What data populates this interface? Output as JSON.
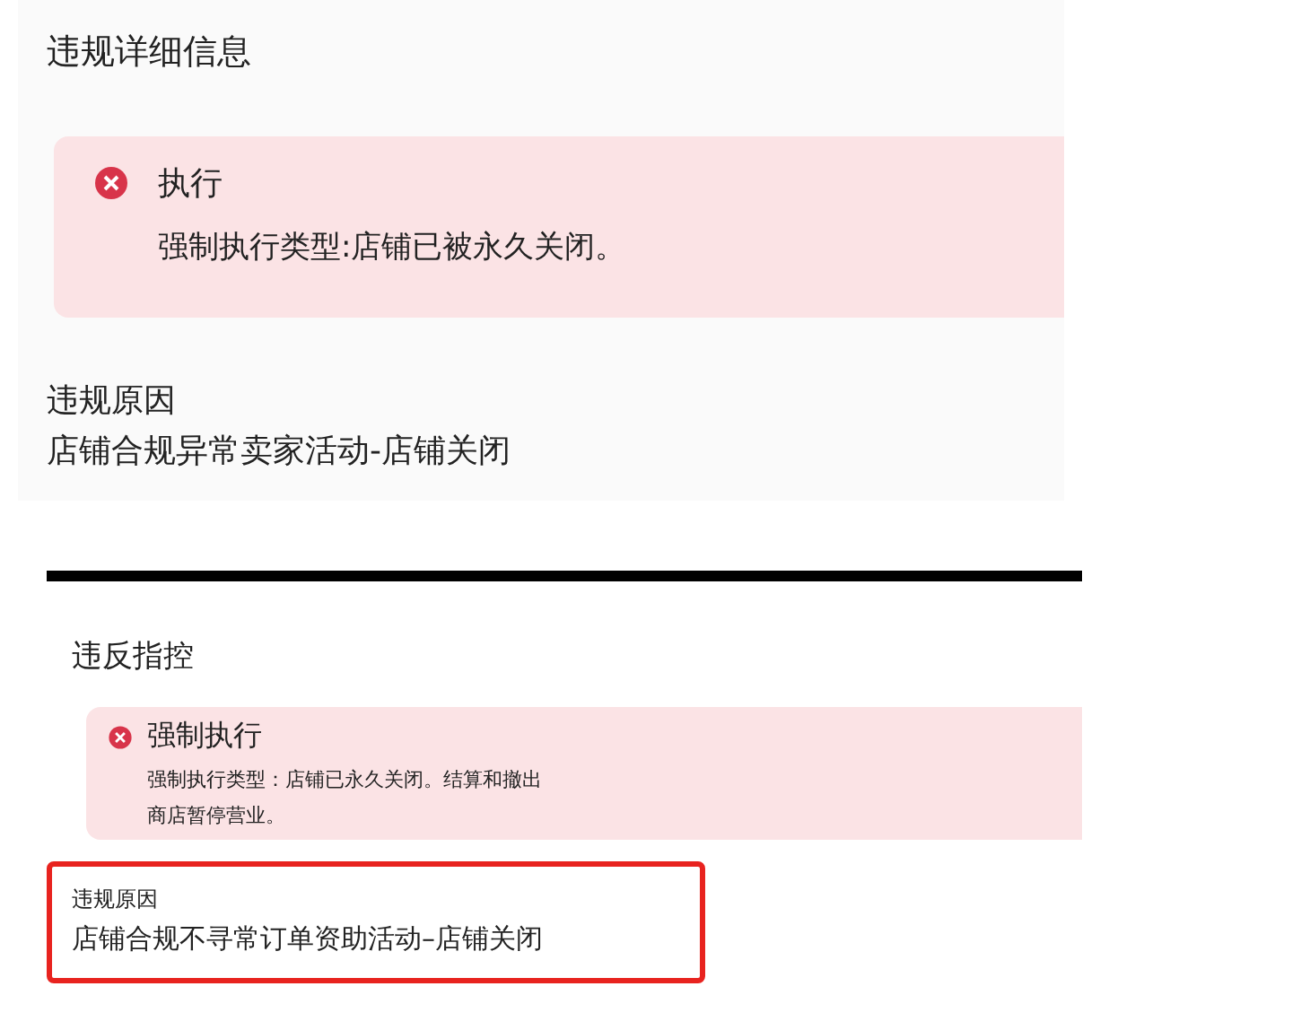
{
  "panels": [
    {
      "title": "违规详细信息",
      "alert": {
        "title": "执行",
        "lines": [
          "强制执行类型:店铺已被永久关闭。"
        ]
      },
      "reason": {
        "label": "违规原因",
        "value": "店铺合规异常卖家活动-店铺关闭",
        "highlighted": false
      }
    },
    {
      "title": "违反指控",
      "alert": {
        "title": "强制执行",
        "lines": [
          "强制执行类型：店铺已永久关闭。结算和撤出",
          "商店暂停营业。"
        ]
      },
      "reason": {
        "label": "违规原因",
        "value": "店铺合规不寻常订单资助活动–店铺关闭",
        "highlighted": true
      }
    }
  ]
}
